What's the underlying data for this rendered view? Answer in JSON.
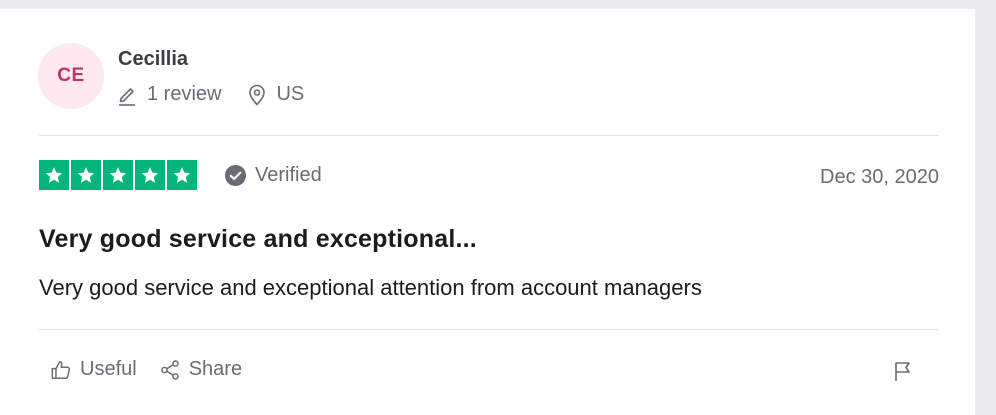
{
  "reviewer": {
    "initials": "CE",
    "name": "Cecillia",
    "review_count": "1 review",
    "country": "US"
  },
  "review": {
    "rating": 5,
    "verified_label": "Verified",
    "date": "Dec 30, 2020",
    "title": "Very good service and exceptional...",
    "text": "Very good service and exceptional attention from account managers"
  },
  "actions": {
    "useful_label": "Useful",
    "share_label": "Share"
  },
  "icons": {
    "pencil": "pencil-icon",
    "location": "location-pin-icon",
    "star": "star-icon",
    "verified": "verified-check-icon",
    "thumbs_up": "thumbs-up-icon",
    "share": "share-icon",
    "flag": "flag-icon"
  },
  "colors": {
    "star_green": "#00b67a",
    "avatar_bg": "#fde9ef",
    "avatar_text": "#c4325f",
    "muted_text": "#6b6b78"
  }
}
